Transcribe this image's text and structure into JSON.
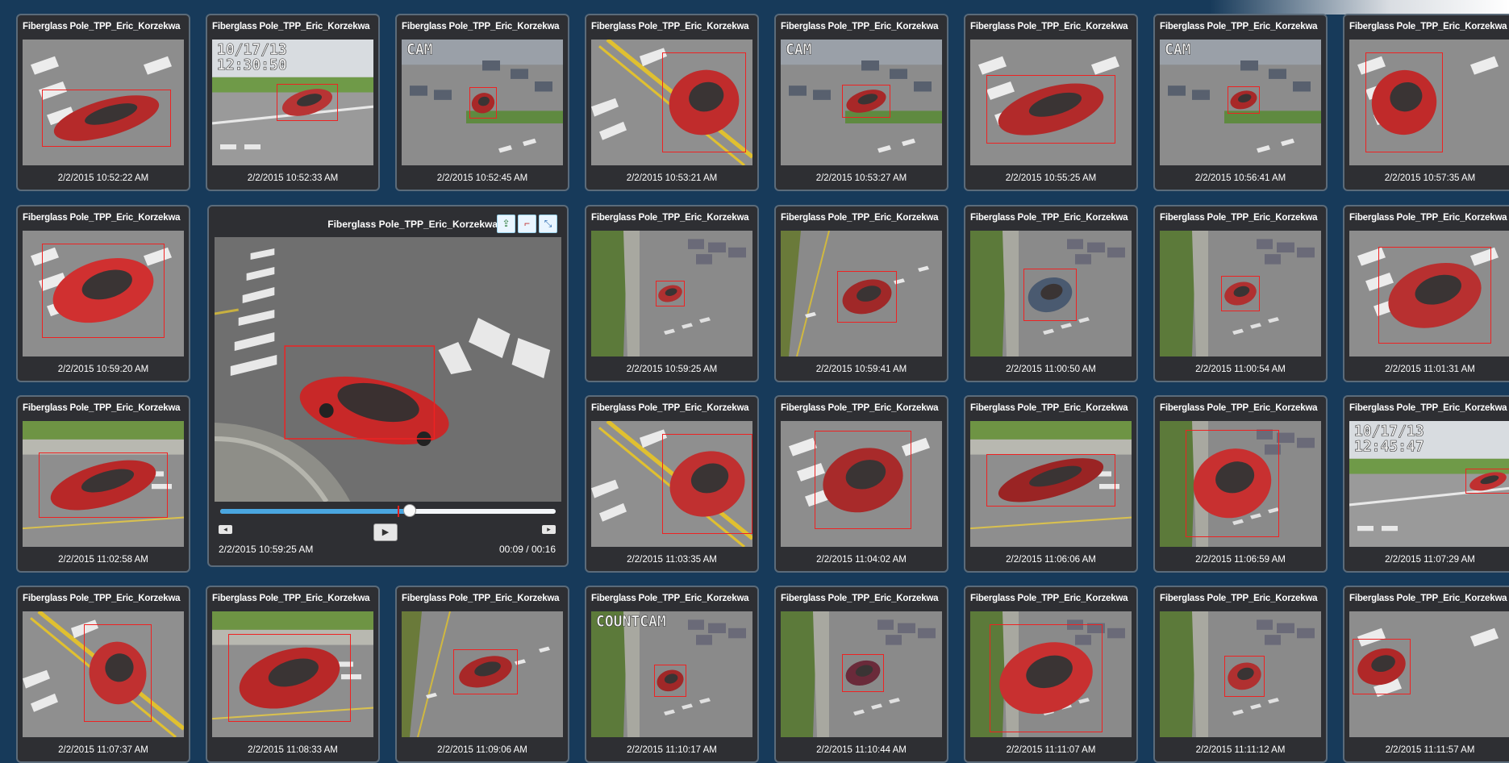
{
  "tiles": [
    {
      "title": "Fiberglass Pole_TPP_Eric_Korzekwa",
      "timestamp": "2/2/2015 10:52:22 AM",
      "scene": "crosswalk",
      "car": "#b52a2a"
    },
    {
      "title": "Fiberglass Pole_TPP_Eric_Korzekwa",
      "timestamp": "2/2/2015 10:52:33 AM",
      "scene": "osd",
      "osd": "10/17/13\n12:30:50",
      "car": "#b83434"
    },
    {
      "title": "Fiberglass Pole_TPP_Eric_Korzekwa",
      "timestamp": "2/2/2015 10:52:45 AM",
      "scene": "lot",
      "osd": "CAM",
      "car": "#a82828"
    },
    {
      "title": "Fiberglass Pole_TPP_Eric_Korzekwa",
      "timestamp": "2/2/2015 10:53:21 AM",
      "scene": "yellow",
      "car": "#c02c2c"
    },
    {
      "title": "Fiberglass Pole_TPP_Eric_Korzekwa",
      "timestamp": "2/2/2015 10:53:27 AM",
      "scene": "lot",
      "osd": "CAM",
      "car": "#a82828"
    },
    {
      "title": "Fiberglass Pole_TPP_Eric_Korzekwa",
      "timestamp": "2/2/2015 10:55:25 AM",
      "scene": "crosswalk",
      "car": "#b22a2a"
    },
    {
      "title": "Fiberglass Pole_TPP_Eric_Korzekwa",
      "timestamp": "2/2/2015 10:56:41 AM",
      "scene": "lot",
      "osd": "CAM",
      "car": "#a82828"
    },
    {
      "title": "Fiberglass Pole_TPP_Eric_Korzekwa",
      "timestamp": "2/2/2015 10:57:35 AM",
      "scene": "crosswalk",
      "car": "#c02a2a"
    },
    {
      "title": "Fiberglass Pole_TPP_Eric_Korzekwa",
      "timestamp": "2/2/2015 10:59:20 AM",
      "scene": "crosswalk",
      "car": "#d03030"
    },
    {
      "title": "Fiberglass Pole_TPP_Eric_Korzekwa",
      "timestamp": "2/2/2015 10:59:25 AM",
      "scene": "trees",
      "car": "#b03030"
    },
    {
      "title": "Fiberglass Pole_TPP_Eric_Korzekwa",
      "timestamp": "2/2/2015 10:59:41 AM",
      "scene": "road",
      "car": "#a02828"
    },
    {
      "title": "Fiberglass Pole_TPP_Eric_Korzekwa",
      "timestamp": "2/2/2015 11:00:50 AM",
      "scene": "trees",
      "car": "#4a5a70"
    },
    {
      "title": "Fiberglass Pole_TPP_Eric_Korzekwa",
      "timestamp": "2/2/2015 11:00:54 AM",
      "scene": "trees",
      "car": "#b03030"
    },
    {
      "title": "Fiberglass Pole_TPP_Eric_Korzekwa",
      "timestamp": "2/2/2015 11:01:31 AM",
      "scene": "crosswalk",
      "car": "#b83030"
    },
    {
      "title": "Fiberglass Pole_TPP_Eric_Korzekwa",
      "timestamp": "2/2/2015 11:02:58 AM",
      "scene": "street",
      "car": "#b82828"
    },
    {
      "title": "Fiberglass Pole_TPP_Eric_Korzekwa",
      "timestamp": "2/2/2015 11:03:35 AM",
      "scene": "yellow",
      "car": "#c03030"
    },
    {
      "title": "Fiberglass Pole_TPP_Eric_Korzekwa",
      "timestamp": "2/2/2015 11:04:02 AM",
      "scene": "crosswalk",
      "car": "#a82a2a"
    },
    {
      "title": "Fiberglass Pole_TPP_Eric_Korzekwa",
      "timestamp": "2/2/2015 11:06:06 AM",
      "scene": "street",
      "car": "#9a2424"
    },
    {
      "title": "Fiberglass Pole_TPP_Eric_Korzekwa",
      "timestamp": "2/2/2015 11:06:59 AM",
      "scene": "trees",
      "car": "#c83030"
    },
    {
      "title": "Fiberglass Pole_TPP_Eric_Korzekwa",
      "timestamp": "2/2/2015 11:07:29 AM",
      "scene": "osd",
      "osd": "10/17/13\n12:45:47",
      "car": "#c03030"
    },
    {
      "title": "Fiberglass Pole_TPP_Eric_Korzekwa",
      "timestamp": "2/2/2015 11:07:37 AM",
      "scene": "yellow",
      "car": "#c03030"
    },
    {
      "title": "Fiberglass Pole_TPP_Eric_Korzekwa",
      "timestamp": "2/2/2015 11:08:33 AM",
      "scene": "street",
      "car": "#b82828"
    },
    {
      "title": "Fiberglass Pole_TPP_Eric_Korzekwa",
      "timestamp": "2/2/2015 11:09:06 AM",
      "scene": "road",
      "car": "#a82828"
    },
    {
      "title": "Fiberglass Pole_TPP_Eric_Korzekwa",
      "timestamp": "2/2/2015 11:10:17 AM",
      "scene": "trees",
      "osd": "COUNTCAM",
      "car": "#a02828"
    },
    {
      "title": "Fiberglass Pole_TPP_Eric_Korzekwa",
      "timestamp": "2/2/2015 11:10:44 AM",
      "scene": "trees",
      "car": "#6a2a3a"
    },
    {
      "title": "Fiberglass Pole_TPP_Eric_Korzekwa",
      "timestamp": "2/2/2015 11:11:07 AM",
      "scene": "trees",
      "car": "#c83030"
    },
    {
      "title": "Fiberglass Pole_TPP_Eric_Korzekwa",
      "timestamp": "2/2/2015 11:11:12 AM",
      "scene": "trees",
      "car": "#b03030"
    },
    {
      "title": "Fiberglass Pole_TPP_Eric_Korzekwa",
      "timestamp": "2/2/2015 11:11:57 AM",
      "scene": "crosswalk",
      "car": "#b02828"
    }
  ],
  "player": {
    "title": "Fiberglass Pole_TPP_Eric_Korzekwa",
    "timestamp": "2/2/2015 10:59:25 AM",
    "progress_text": "00:09 / 00:16",
    "progress": 0.5625,
    "buttons": [
      "export-icon",
      "bookmark-icon",
      "expand-icon"
    ],
    "car_color": "#d02a2a"
  },
  "colors": {
    "background": "#173a5a",
    "tile": "#2e2f33",
    "highlight": "#ee2222",
    "accent": "#4aa6e0"
  }
}
